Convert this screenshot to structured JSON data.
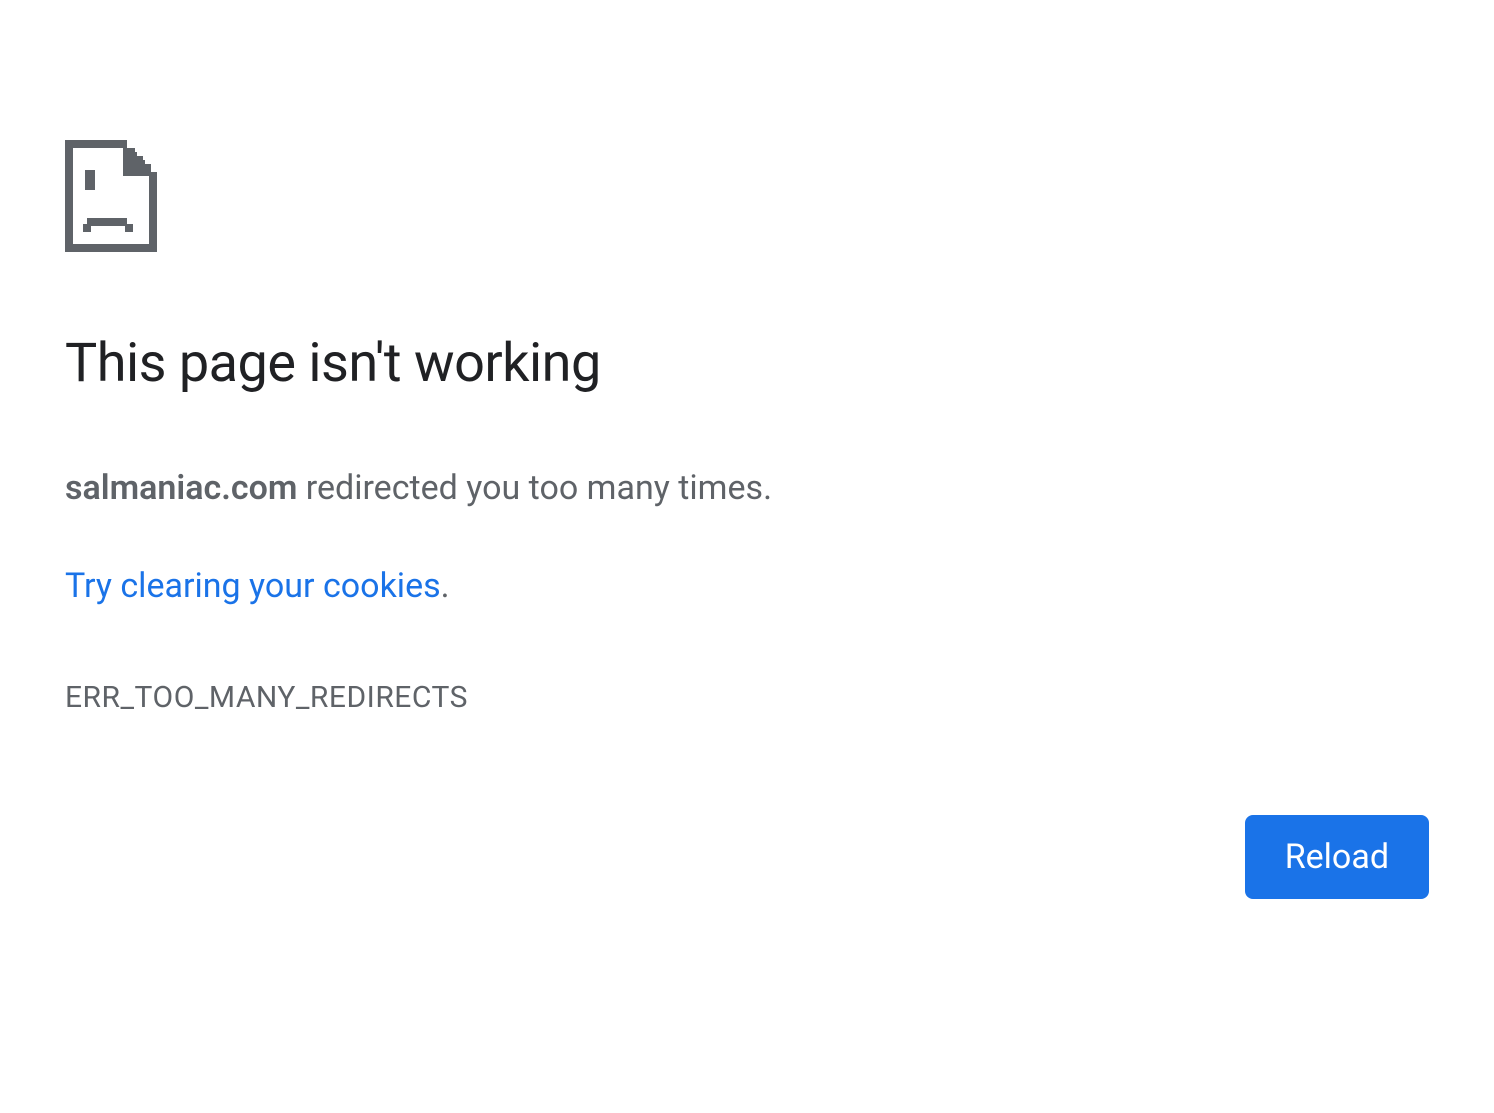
{
  "error": {
    "heading": "This page isn't working",
    "domain": "salmaniac.com",
    "description_suffix": " redirected you too many times.",
    "suggestion_link_text": "Try clearing your cookies",
    "suggestion_period": ".",
    "error_code": "ERR_TOO_MANY_REDIRECTS"
  },
  "actions": {
    "reload_label": "Reload"
  },
  "colors": {
    "link": "#1a73e8",
    "button_bg": "#1a73e8",
    "text_primary": "#202124",
    "text_secondary": "#5f6368"
  }
}
